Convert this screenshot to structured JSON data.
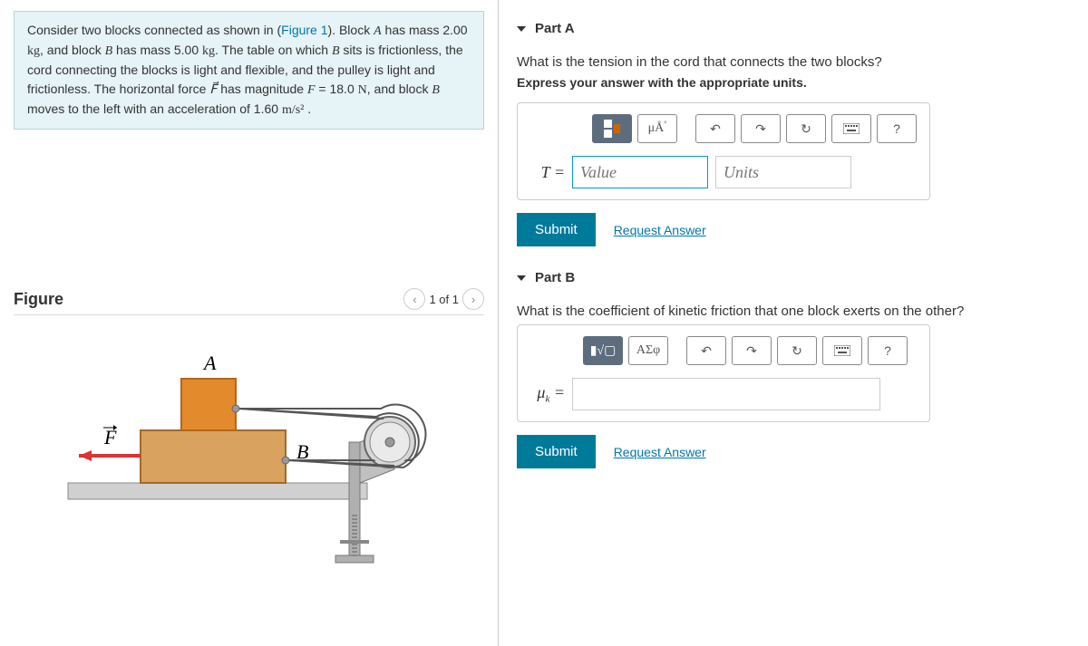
{
  "problem": {
    "html": "Consider two blocks connected as shown in (<a data-name='figure-link' data-interactable='true'>Figure 1</a>). Block <span class='math'><i>A</i></span> has mass 2.00 <span class='math'>kg</span>, and block <span class='math'><i>B</i></span> has mass 5.00 <span class='math'>kg</span>. The table on which <span class='math'><i>B</i></span> sits is frictionless, the cord connecting the blocks is light and flexible, and the pulley is light and frictionless. The horizontal force <span class='math'><i>F⃗</i></span> has magnitude <span class='math'><i>F</i></span> = 18.0 <span class='math'>N</span>, and block <span class='math'><i>B</i></span> moves to the left with an acceleration of 1.60 <span class='math'>m/s²</span> ."
  },
  "figure": {
    "title": "Figure",
    "pager": "1 of 1",
    "labels": {
      "A": "A",
      "B": "B",
      "F": "F⃗"
    }
  },
  "partA": {
    "title": "Part A",
    "question": "What is the tension in the cord that connects the two blocks?",
    "instruction": "Express your answer with the appropriate units.",
    "var_label": "T =",
    "value_placeholder": "Value",
    "units_placeholder": "Units",
    "toolbar": {
      "units_btn": "μÅ",
      "help": "?"
    },
    "submit": "Submit",
    "request": "Request Answer"
  },
  "partB": {
    "title": "Part B",
    "question": "What is the coefficient of kinetic friction that one block exerts on the other?",
    "var_label": "μk =",
    "toolbar": {
      "greek": "ΑΣφ",
      "help": "?"
    },
    "submit": "Submit",
    "request": "Request Answer"
  }
}
